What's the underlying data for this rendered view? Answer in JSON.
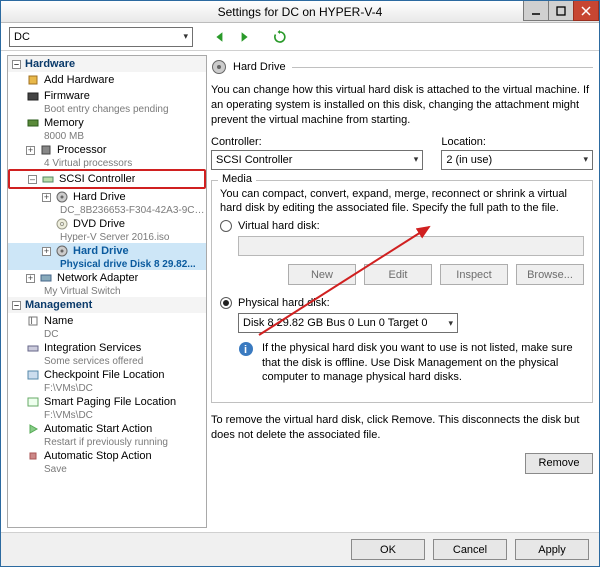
{
  "window": {
    "title": "Settings for DC on HYPER-V-4"
  },
  "toolbar": {
    "vm_selected": "DC"
  },
  "sidebar": {
    "hardware_header": "Hardware",
    "management_header": "Management",
    "items": {
      "add_hardware": "Add Hardware",
      "firmware": "Firmware",
      "firmware_sub": "Boot entry changes pending",
      "memory": "Memory",
      "memory_sub": "8000 MB",
      "processor": "Processor",
      "processor_sub": "4 Virtual processors",
      "scsi": "SCSI Controller",
      "hard_drive": "Hard Drive",
      "hard_drive_sub": "DC_8B236653-F304-42A3-9C5...",
      "dvd": "DVD Drive",
      "dvd_sub": "Hyper-V Server 2016.iso",
      "hard_drive2": "Hard Drive",
      "hard_drive2_sub": "Physical drive Disk 8 29.82...",
      "nic": "Network Adapter",
      "nic_sub": "My Virtual Switch",
      "name": "Name",
      "name_sub": "DC",
      "integration": "Integration Services",
      "integration_sub": "Some services offered",
      "checkpoint": "Checkpoint File Location",
      "checkpoint_sub": "F:\\VMs\\DC",
      "smartpaging": "Smart Paging File Location",
      "smartpaging_sub": "F:\\VMs\\DC",
      "autostart": "Automatic Start Action",
      "autostart_sub": "Restart if previously running",
      "autostop": "Automatic Stop Action",
      "autostop_sub": "Save"
    }
  },
  "panel": {
    "title": "Hard Drive",
    "desc": "You can change how this virtual hard disk is attached to the virtual machine. If an operating system is installed on this disk, changing the attachment might prevent the virtual machine from starting.",
    "controller_label": "Controller:",
    "controller_value": "SCSI Controller",
    "location_label": "Location:",
    "location_value": "2 (in use)",
    "media_group": "Media",
    "media_desc": "You can compact, convert, expand, merge, reconnect or shrink a virtual hard disk by editing the associated file. Specify the full path to the file.",
    "vhd_radio": "Virtual hard disk:",
    "phd_radio": "Physical hard disk:",
    "phd_value": "Disk 8 29.82 GB Bus 0 Lun 0 Target 0",
    "info_text": "If the physical hard disk you want to use is not listed, make sure that the disk is offline. Use Disk Management on the physical computer to manage physical hard disks.",
    "remove_desc": "To remove the virtual hard disk, click Remove. This disconnects the disk but does not delete the associated file.",
    "btn_new": "New",
    "btn_edit": "Edit",
    "btn_inspect": "Inspect",
    "btn_browse": "Browse...",
    "btn_remove": "Remove"
  },
  "footer": {
    "ok": "OK",
    "cancel": "Cancel",
    "apply": "Apply"
  }
}
